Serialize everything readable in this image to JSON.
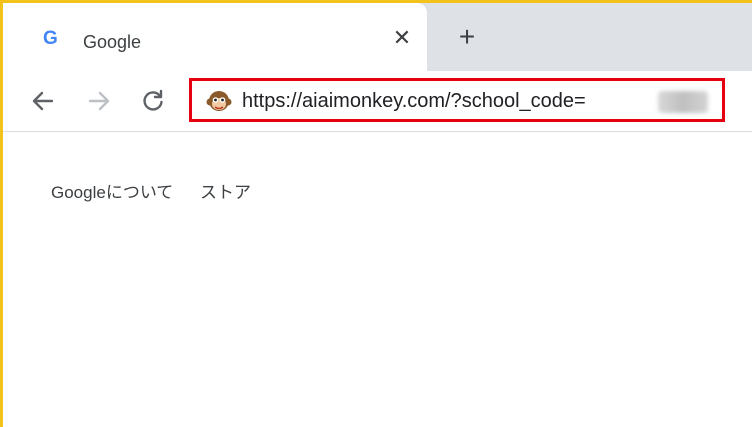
{
  "tab": {
    "title": "Google",
    "favicon_letter": "G",
    "close_glyph": "✕"
  },
  "newtab_glyph": "+",
  "address_bar": {
    "url": "https://aiaimonkey.com/?school_code="
  },
  "page": {
    "links": [
      "Googleについて",
      "ストア"
    ]
  },
  "colors": {
    "frame": "#f3c21b",
    "highlight": "#e60012",
    "google_blue": "#4285f4"
  }
}
